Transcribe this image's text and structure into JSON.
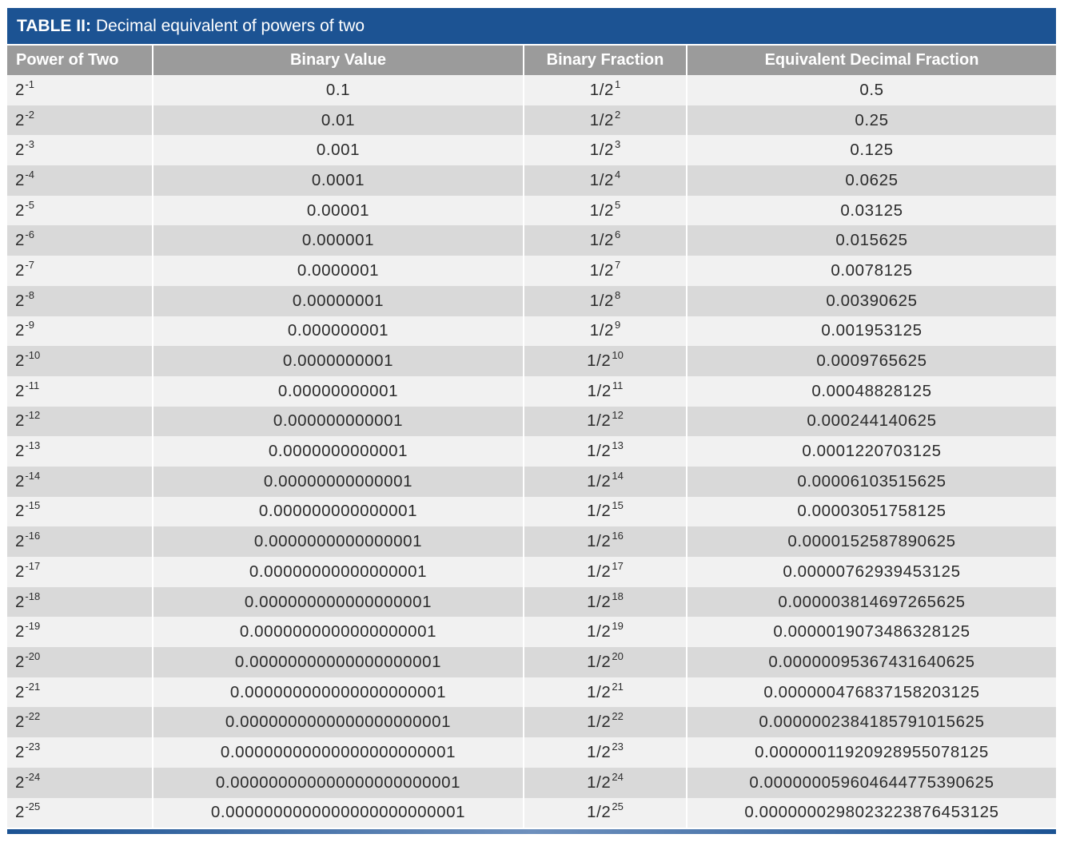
{
  "title": {
    "prefix": "TABLE II:",
    "text": "Decimal equivalent of powers of two"
  },
  "columns": [
    "Power of Two",
    "Binary Value",
    "Binary Fraction",
    "Equivalent Decimal Fraction"
  ],
  "rows": [
    {
      "base": "2",
      "exp": "-1",
      "binary": "0.1",
      "frac_base": "1/2",
      "frac_exp": "1",
      "decimal": "0.5"
    },
    {
      "base": "2",
      "exp": "-2",
      "binary": "0.01",
      "frac_base": "1/2",
      "frac_exp": "2",
      "decimal": "0.25"
    },
    {
      "base": "2",
      "exp": "-3",
      "binary": "0.001",
      "frac_base": "1/2",
      "frac_exp": "3",
      "decimal": "0.125"
    },
    {
      "base": "2",
      "exp": "-4",
      "binary": "0.0001",
      "frac_base": "1/2",
      "frac_exp": "4",
      "decimal": "0.0625"
    },
    {
      "base": "2",
      "exp": "-5",
      "binary": "0.00001",
      "frac_base": "1/2",
      "frac_exp": "5",
      "decimal": "0.03125"
    },
    {
      "base": "2",
      "exp": "-6",
      "binary": "0.000001",
      "frac_base": "1/2",
      "frac_exp": "6",
      "decimal": "0.015625"
    },
    {
      "base": "2",
      "exp": "-7",
      "binary": "0.0000001",
      "frac_base": "1/2",
      "frac_exp": "7",
      "decimal": "0.0078125"
    },
    {
      "base": "2",
      "exp": "-8",
      "binary": "0.00000001",
      "frac_base": "1/2",
      "frac_exp": "8",
      "decimal": "0.00390625"
    },
    {
      "base": "2",
      "exp": "-9",
      "binary": "0.000000001",
      "frac_base": "1/2",
      "frac_exp": "9",
      "decimal": "0.001953125"
    },
    {
      "base": "2",
      "exp": "-10",
      "binary": "0.0000000001",
      "frac_base": "1/2",
      "frac_exp": "10",
      "decimal": "0.0009765625"
    },
    {
      "base": "2",
      "exp": "-11",
      "binary": "0.00000000001",
      "frac_base": "1/2",
      "frac_exp": "11",
      "decimal": "0.00048828125"
    },
    {
      "base": "2",
      "exp": "-12",
      "binary": "0.000000000001",
      "frac_base": "1/2",
      "frac_exp": "12",
      "decimal": "0.000244140625"
    },
    {
      "base": "2",
      "exp": "-13",
      "binary": "0.0000000000001",
      "frac_base": "1/2",
      "frac_exp": "13",
      "decimal": "0.0001220703125"
    },
    {
      "base": "2",
      "exp": "-14",
      "binary": "0.00000000000001",
      "frac_base": "1/2",
      "frac_exp": "14",
      "decimal": "0.00006103515625"
    },
    {
      "base": "2",
      "exp": "-15",
      "binary": "0.000000000000001",
      "frac_base": "1/2",
      "frac_exp": "15",
      "decimal": "0.00003051758125"
    },
    {
      "base": "2",
      "exp": "-16",
      "binary": "0.0000000000000001",
      "frac_base": "1/2",
      "frac_exp": "16",
      "decimal": "0.0000152587890625"
    },
    {
      "base": "2",
      "exp": "-17",
      "binary": "0.00000000000000001",
      "frac_base": "1/2",
      "frac_exp": "17",
      "decimal": "0.00000762939453125"
    },
    {
      "base": "2",
      "exp": "-18",
      "binary": "0.000000000000000001",
      "frac_base": "1/2",
      "frac_exp": "18",
      "decimal": "0.000003814697265625"
    },
    {
      "base": "2",
      "exp": "-19",
      "binary": "0.0000000000000000001",
      "frac_base": "1/2",
      "frac_exp": "19",
      "decimal": "0.0000019073486328125"
    },
    {
      "base": "2",
      "exp": "-20",
      "binary": "0.00000000000000000001",
      "frac_base": "1/2",
      "frac_exp": "20",
      "decimal": "0.00000095367431640625"
    },
    {
      "base": "2",
      "exp": "-21",
      "binary": "0.000000000000000000001",
      "frac_base": "1/2",
      "frac_exp": "21",
      "decimal": "0.000000476837158203125"
    },
    {
      "base": "2",
      "exp": "-22",
      "binary": "0.0000000000000000000001",
      "frac_base": "1/2",
      "frac_exp": "22",
      "decimal": "0.0000002384185791015625"
    },
    {
      "base": "2",
      "exp": "-23",
      "binary": "0.00000000000000000000001",
      "frac_base": "1/2",
      "frac_exp": "23",
      "decimal": "0.00000011920928955078125"
    },
    {
      "base": "2",
      "exp": "-24",
      "binary": "0.000000000000000000000001",
      "frac_base": "1/2",
      "frac_exp": "24",
      "decimal": "0.000000059604644775390625"
    },
    {
      "base": "2",
      "exp": "-25",
      "binary": "0.0000000000000000000000001",
      "frac_base": "1/2",
      "frac_exp": "25",
      "decimal": "0.0000000298023223876453125"
    }
  ],
  "colors": {
    "title_bg": "#1c5393",
    "header_bg": "#9b9b9b",
    "row_light": "#f1f1f1",
    "row_dark": "#d9d9d9"
  }
}
